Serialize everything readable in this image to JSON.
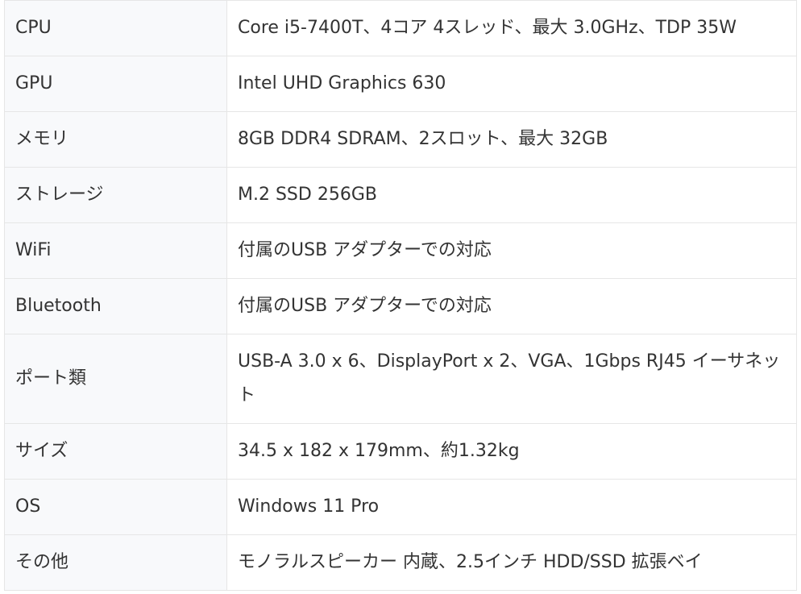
{
  "spec_table": {
    "rows": [
      {
        "label": "CPU",
        "value": "Core i5-7400T、4コア 4スレッド、最大 3.0GHz、TDP 35W"
      },
      {
        "label": "GPU",
        "value": "Intel UHD Graphics 630"
      },
      {
        "label": "メモリ",
        "value": "8GB DDR4 SDRAM、2スロット、最大 32GB"
      },
      {
        "label": "ストレージ",
        "value": "M.2 SSD 256GB"
      },
      {
        "label": "WiFi",
        "value": "付属のUSB アダプターでの対応"
      },
      {
        "label": "Bluetooth",
        "value": "付属のUSB アダプターでの対応"
      },
      {
        "label": "ポート類",
        "value": "USB-A 3.0 x 6、DisplayPort x 2、VGA、1Gbps RJ45 イーサネット"
      },
      {
        "label": "サイズ",
        "value": "34.5 x 182 x 179mm、約1.32kg"
      },
      {
        "label": "OS",
        "value": "Windows 11 Pro"
      },
      {
        "label": "その他",
        "value": "モノラルスピーカー 内蔵、2.5インチ HDD/SSD 拡張ベイ"
      }
    ]
  }
}
